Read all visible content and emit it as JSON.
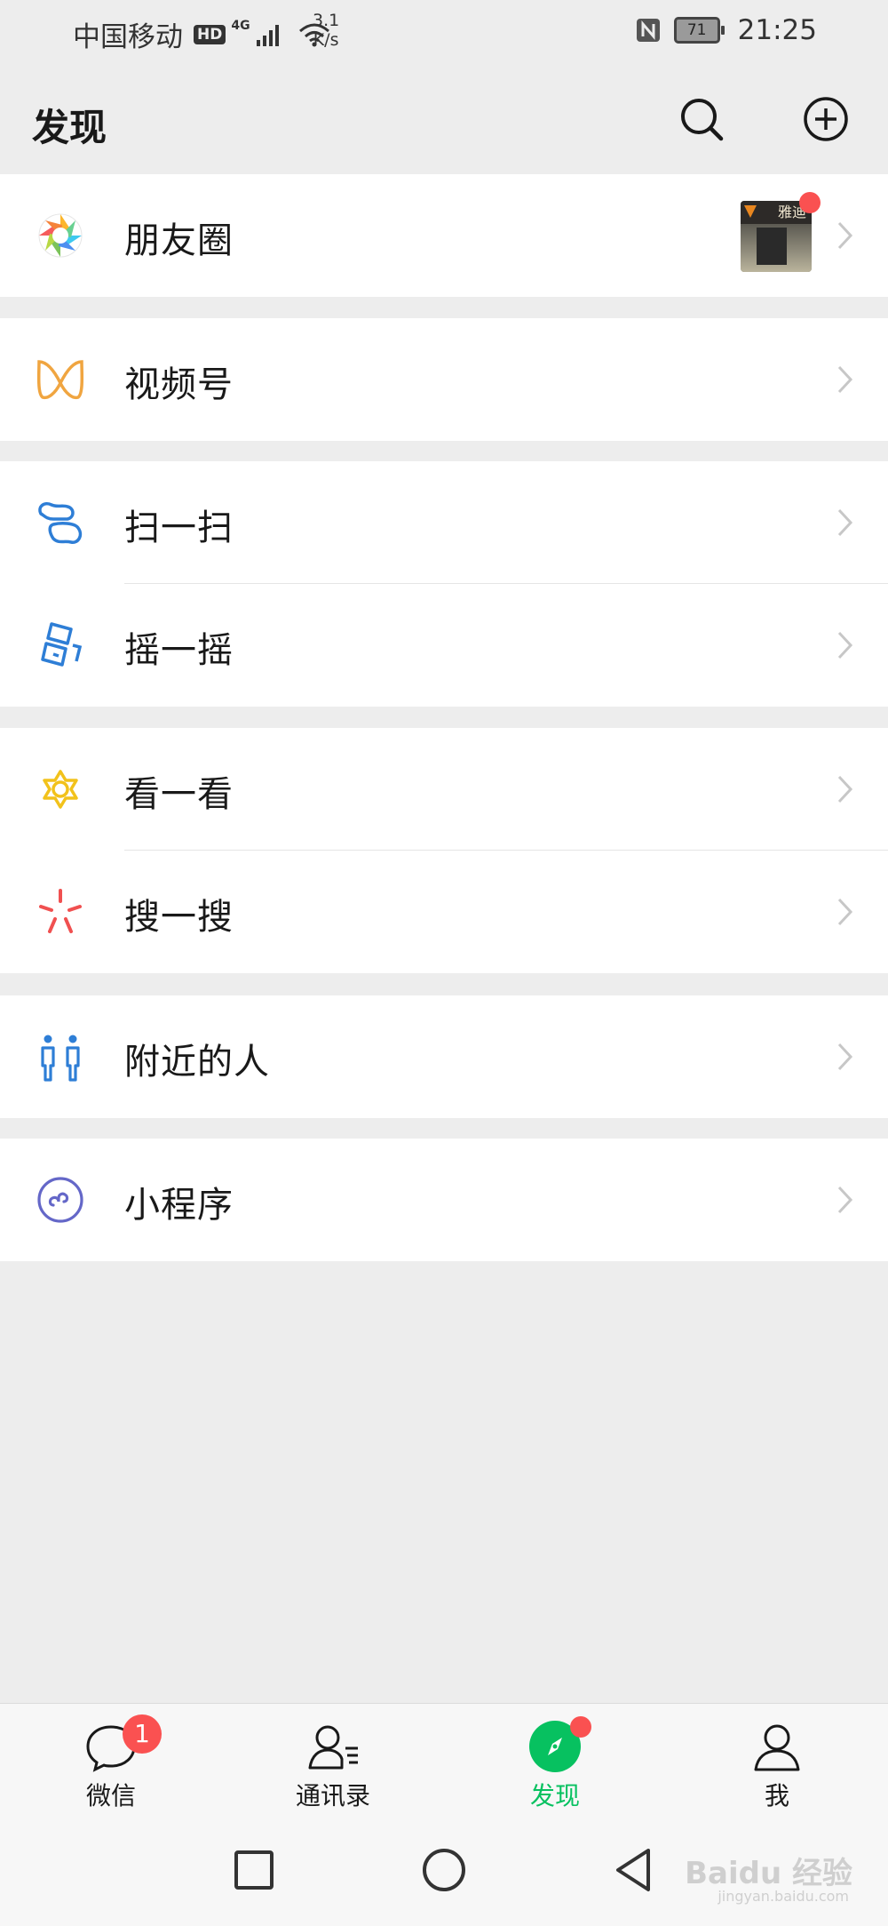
{
  "status_bar": {
    "carrier": "中国移动",
    "hd": "HD",
    "network": "4G",
    "speed_value": "3.1",
    "speed_unit": "K/s",
    "battery": "71",
    "time": "21:25"
  },
  "header": {
    "title": "发现",
    "search_icon": "search-icon",
    "add_icon": "plus-circle-icon"
  },
  "menu": {
    "moments": "朋友圈",
    "channels": "视频号",
    "scan": "扫一扫",
    "shake": "摇一摇",
    "top_stories": "看一看",
    "search": "搜一搜",
    "nearby": "附近的人",
    "mini_programs": "小程序"
  },
  "moments_thumb_sign": "雅迪",
  "tabbar": {
    "chats": "微信",
    "chats_badge": "1",
    "contacts": "通讯录",
    "discover": "发现",
    "me": "我"
  },
  "colors": {
    "accent": "#07c160",
    "badge": "#fa5151",
    "background": "#ededed"
  },
  "watermark": {
    "main": "Baidu 经验",
    "sub": "jingyan.baidu.com"
  }
}
